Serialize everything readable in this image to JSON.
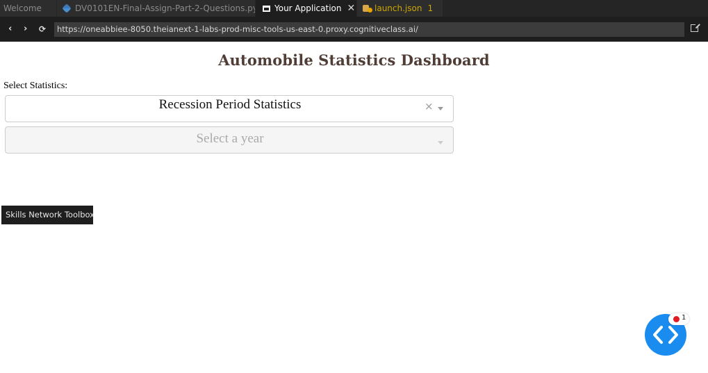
{
  "tabs": [
    {
      "label": "Welcome",
      "icon": ""
    },
    {
      "label": "DV0101EN-Final-Assign-Part-2-Questions.py",
      "icon": "python-file-icon"
    },
    {
      "label": "Your Application",
      "icon": "preview-window-icon",
      "close": "✕"
    },
    {
      "label": "launch.json",
      "icon": "json-config-icon",
      "badge": "1"
    }
  ],
  "browser": {
    "back": "‹",
    "forward": "›",
    "reload": "⟳",
    "url": "https://oneabbiee-8050.theianext-1-labs-prod-misc-tools-us-east-0.proxy.cognitiveclass.ai/"
  },
  "page": {
    "title": "Automobile Statistics Dashboard",
    "select_label": "Select Statistics:",
    "statistics_dropdown": {
      "value": "Recession Period Statistics",
      "clear": "×"
    },
    "year_dropdown": {
      "placeholder": "Select a year"
    }
  },
  "tooltip": {
    "text": "Skills Network Toolbox"
  },
  "fab": {
    "icon": "code-brackets-icon",
    "badge_count": "1"
  },
  "colors": {
    "title": "#503d36",
    "fab": "#1a8cf0",
    "badge_dot": "#e01b24",
    "tab_active_bg": "#1e1e1e",
    "warning": "#cca700"
  }
}
